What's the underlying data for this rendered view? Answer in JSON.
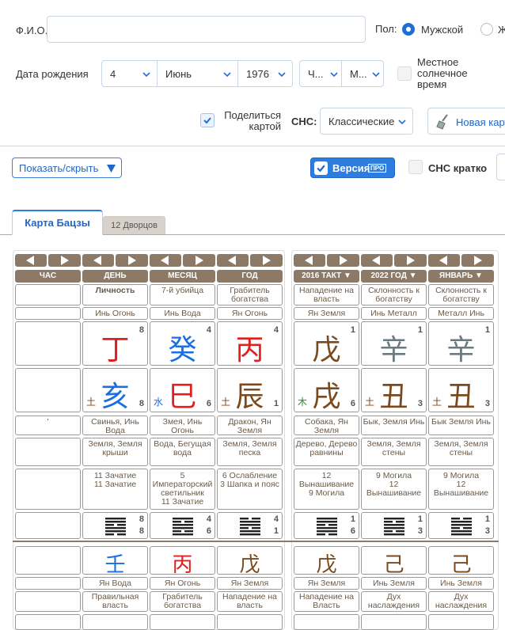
{
  "form": {
    "fio_label": "Ф.И.О.",
    "fio_value": "",
    "sex_label": "Пол:",
    "sex_male": "Мужской",
    "sex_female": "Ж",
    "birth_label": "Дата рождения",
    "day": "4",
    "month": "Июнь",
    "year": "1976",
    "hour": "Ч...",
    "minute": "М...",
    "solar_label": "Местное солнечное время",
    "share_label": "Поделиться картой",
    "sns_label": "СНС:",
    "sns_value": "Классические",
    "new_card": "Новая карт"
  },
  "toolbar": {
    "show_hide": "Показать/скрыть",
    "version": "Версия",
    "pro": "ПРО",
    "sns_short": "СНС кратко"
  },
  "tabs": [
    "Карта Бацзы",
    "12 Дворцов"
  ],
  "colors": {
    "wood": "#2e8b2e",
    "fire": "#e02020",
    "earth": "#7a4a1e",
    "metal": "#6b7a80",
    "water": "#1a6fe0",
    "header": "#8c7a66"
  },
  "columns": [
    {
      "head": "ЧАС",
      "rel": "",
      "elem": "",
      "stem": "",
      "stem_n": "",
      "branch": "",
      "branch_n": "",
      "branch_mark": "",
      "animal": "'",
      "naiyin": "",
      "stage": "",
      "stars": [],
      "gua": "",
      "gua_n": [
        "",
        ""
      ],
      "stem2": "",
      "stem2_elem": "",
      "stem2_rel": ""
    },
    {
      "head": "ДЕНЬ",
      "rel": "Личность",
      "elem": "Инь Огонь",
      "stem": "丁",
      "stem_c": "fire",
      "stem_n": "8",
      "branch": "亥",
      "branch_c": "water",
      "branch_n": "8",
      "branch_mark": "土",
      "branch_mark_c": "earth",
      "animal": "Свинья, Инь Вода",
      "naiyin": "Земля, Земля крыши",
      "stage": "",
      "stars": [
        "11 Зачатие",
        "11 Зачатие"
      ],
      "gua": "䷁",
      "gua_n": [
        "8",
        "8"
      ],
      "stem2": "壬",
      "stem2_c": "water",
      "stem2_elem": "Ян Вода",
      "stem2_rel": "Правильная власть"
    },
    {
      "head": "МЕСЯЦ",
      "rel": "7-й убийца",
      "elem": "Инь Вода",
      "stem": "癸",
      "stem_c": "water",
      "stem_n": "4",
      "branch": "巳",
      "branch_c": "fire",
      "branch_n": "6",
      "branch_mark": "水",
      "branch_mark_c": "water",
      "animal": "Змея, Инь Огонь",
      "naiyin": "Вода, Бегущая вода",
      "stars": [
        "5 Императорский светильник",
        "11 Зачатие"
      ],
      "gua": "䷂",
      "gua_n": [
        "4",
        "6"
      ],
      "stem2": "丙",
      "stem2_c": "fire",
      "stem2_elem": "Ян Огонь",
      "stem2_rel": "Грабитель богатства"
    },
    {
      "head": "ГОД",
      "rel": "Грабитель богатства",
      "elem": "Ян Огонь",
      "stem": "丙",
      "stem_c": "fire",
      "stem_n": "4",
      "branch": "辰",
      "branch_c": "earth",
      "branch_n": "1",
      "branch_mark": "土",
      "branch_mark_c": "earth",
      "animal": "Дракон, Ян Земля",
      "naiyin": "Земля, Земля песка",
      "stars": [
        "6 Ослабление",
        "3 Шапка и пояс"
      ],
      "gua": "䷃",
      "gua_n": [
        "4",
        "1"
      ],
      "stem2": "戊",
      "stem2_c": "earth",
      "stem2_elem": "Ян Земля",
      "stem2_rel": "Нападение на власть"
    },
    {
      "head": "2016 ТАКТ ▼",
      "rel": "Нападение на власть",
      "elem": "Ян Земля",
      "stem": "戊",
      "stem_c": "earth",
      "stem_n": "1",
      "branch": "戌",
      "branch_c": "earth",
      "branch_n": "6",
      "branch_mark": "木",
      "branch_mark_c": "wood",
      "animal": "Собака, Ян Земля",
      "naiyin": "Дерево, Дерево равнины",
      "stars": [
        "12 Вынашивание",
        "9 Могила"
      ],
      "gua": "䷄",
      "gua_n": [
        "1",
        "6"
      ],
      "stem2": "戊",
      "stem2_c": "earth",
      "stem2_elem": "Ян Земля",
      "stem2_rel": "Нападение на Власть"
    },
    {
      "head": "2022 ГОД ▼",
      "rel": "Склонность к богатству",
      "elem": "Инь Металл",
      "stem": "辛",
      "stem_c": "metal",
      "stem_n": "1",
      "branch": "丑",
      "branch_c": "earth",
      "branch_n": "3",
      "branch_mark": "土",
      "branch_mark_c": "earth",
      "animal": "Бык, Земля Инь",
      "naiyin": "Земля, Земля стены",
      "stars": [
        "9 Могила",
        "12 Вынашивание"
      ],
      "gua": "䷅",
      "gua_n": [
        "1",
        "3"
      ],
      "stem2": "己",
      "stem2_c": "earth",
      "stem2_elem": "Инь Земля",
      "stem2_rel": "Дух наслаждения"
    },
    {
      "head": "ЯНВАРЬ ▼",
      "rel": "Склонность к богатству",
      "elem": "Металл Инь",
      "stem": "辛",
      "stem_c": "metal",
      "stem_n": "1",
      "branch": "丑",
      "branch_c": "earth",
      "branch_n": "3",
      "branch_mark": "土",
      "branch_mark_c": "earth",
      "animal": "Бык Земля Инь",
      "naiyin": "Земля, Земля стены",
      "stars": [
        "9 Могила",
        "12 Вынашивание"
      ],
      "gua": "䷆",
      "gua_n": [
        "1",
        "3"
      ],
      "stem2": "己",
      "stem2_c": "earth",
      "stem2_elem": "Инь Земля",
      "stem2_rel": "Дух наслаждения"
    }
  ]
}
